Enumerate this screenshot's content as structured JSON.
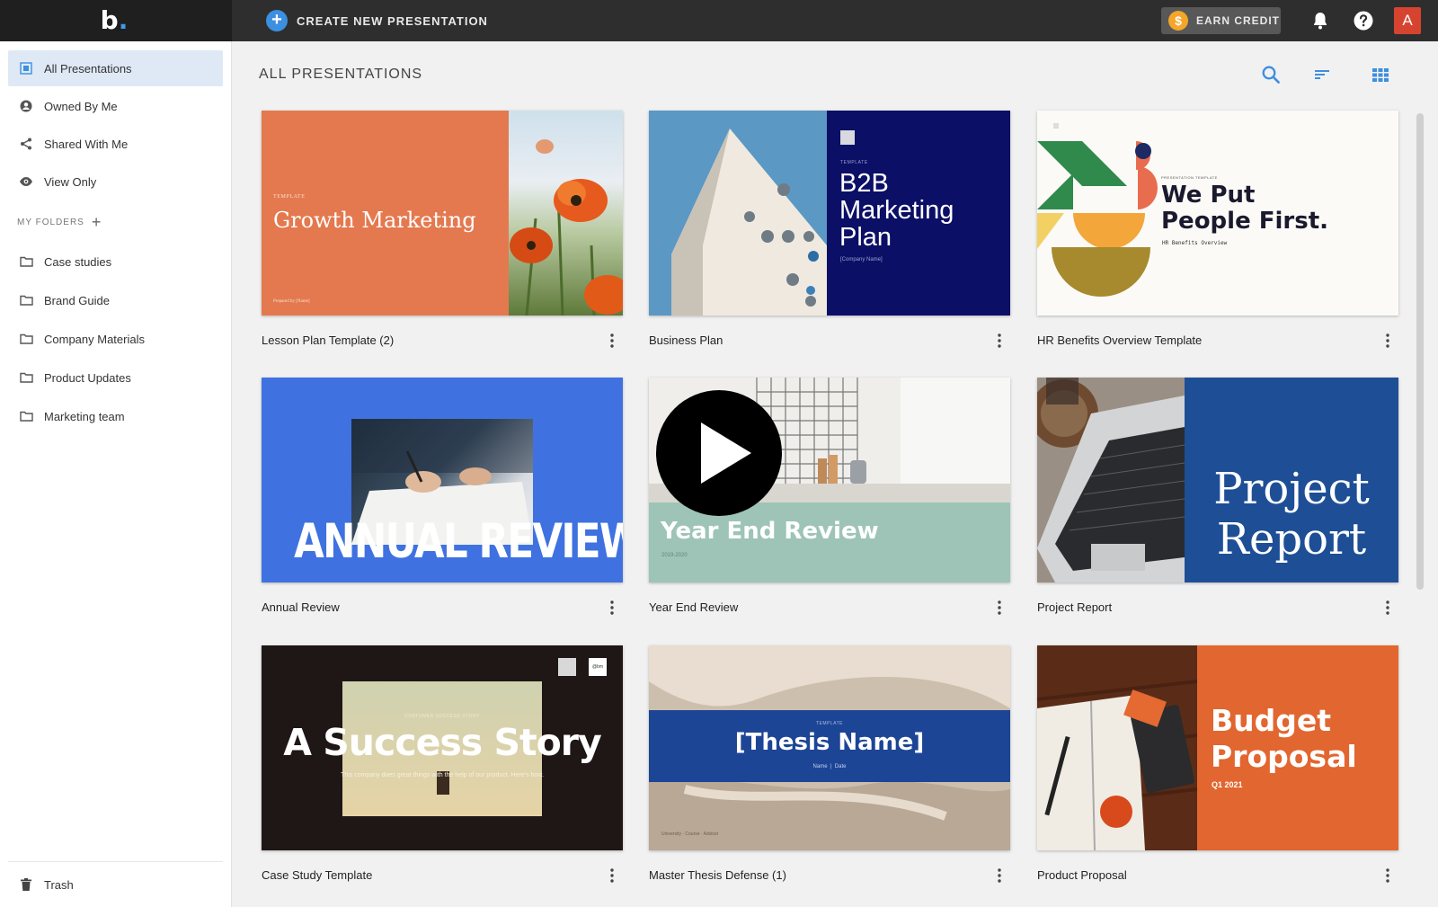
{
  "app": {
    "logo_text": "b",
    "logo_dot": ".",
    "create_label": "CREATE NEW PRESENTATION",
    "earn_credit_label": "EARN CREDIT",
    "coin_symbol": "$",
    "avatar_letter": "A"
  },
  "sidebar": {
    "items": [
      {
        "label": "All Presentations"
      },
      {
        "label": "Owned By Me"
      },
      {
        "label": "Shared With Me"
      },
      {
        "label": "View Only"
      }
    ],
    "folders_header": "MY FOLDERS",
    "folders": [
      {
        "label": "Case studies"
      },
      {
        "label": "Brand Guide"
      },
      {
        "label": "Company Materials"
      },
      {
        "label": "Product Updates"
      },
      {
        "label": "Marketing team"
      }
    ],
    "trash_label": "Trash"
  },
  "main": {
    "title": "ALL PRESENTATIONS"
  },
  "cards": [
    {
      "title": "Lesson Plan Template (2)",
      "thumb_small": "TEMPLATE",
      "thumb_title": "Growth Marketing",
      "thumb_footer": "Prepared by [Name]"
    },
    {
      "title": "Business Plan",
      "thumb_small": "TEMPLATE",
      "thumb_line1": "B2B",
      "thumb_line2": "Marketing",
      "thumb_line3": "Plan",
      "thumb_sub": "[Company Name]"
    },
    {
      "title": "HR Benefits Overview Template",
      "thumb_small": "PRESENTATION TEMPLATE",
      "thumb_line1": "We Put",
      "thumb_line2": "People First.",
      "thumb_sub": "HR Benefits Overview"
    },
    {
      "title": "Annual Review",
      "thumb_title": "ANNUAL REVIEW"
    },
    {
      "title": "Year End Review",
      "thumb_title": "Year End Review",
      "thumb_sub": "2019-2020"
    },
    {
      "title": "Project Report",
      "thumb_line1": "Project",
      "thumb_line2": "Report"
    },
    {
      "title": "Case Study Template",
      "thumb_small": "CUSTOMER SUCCESS STORY",
      "thumb_title": "A Success Story",
      "thumb_sub": "This company does great things with the help of our product. Here's how.",
      "thumb_badge": "@bm"
    },
    {
      "title": "Master Thesis Defense (1)",
      "thumb_small": "TEMPLATE",
      "thumb_title": "[Thesis Name]",
      "thumb_sub": "Name  |  Date",
      "thumb_footer": "University · Course · Advisor"
    },
    {
      "title": "Product Proposal",
      "thumb_line1": "Budget",
      "thumb_line2": "Proposal",
      "thumb_sub": "Q1 2021"
    }
  ],
  "colors": {
    "accent": "#3d8fe0",
    "topbar": "#2e2e2e",
    "active_item": "#dee9f5",
    "avatar": "#d64430",
    "coin": "#f4a62a"
  },
  "icons": {
    "create": "plus-circle-icon",
    "coin": "dollar-coin-icon",
    "notifications": "bell-icon",
    "help": "question-circle-icon",
    "search": "search-icon",
    "sort": "sort-icon",
    "view": "grid-view-icon"
  }
}
